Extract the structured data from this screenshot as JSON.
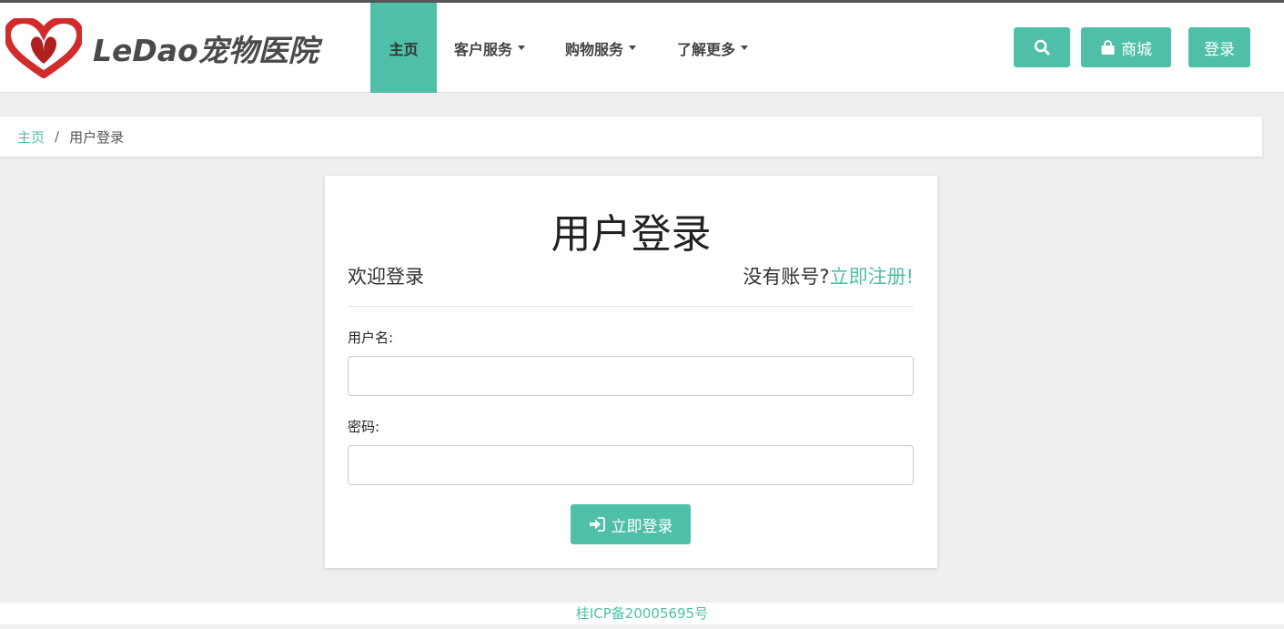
{
  "brand": {
    "text": "LeDao宠物医院",
    "accent_color": "#4fbfa8",
    "logo_icon": "heart-ribbon-logo"
  },
  "nav": {
    "items": [
      {
        "label": "主页",
        "active": true
      },
      {
        "label": "客户服务",
        "dropdown": true
      },
      {
        "label": "购物服务",
        "dropdown": true
      },
      {
        "label": "了解更多",
        "dropdown": true
      }
    ],
    "search_icon": "search-icon",
    "shop_label": "商城",
    "shop_icon": "shopping-bag-icon",
    "login_label": "登录"
  },
  "breadcrumb": {
    "home": "主页",
    "separator": "/",
    "current": "用户登录"
  },
  "login": {
    "title": "用户登录",
    "welcome": "欢迎登录",
    "no_account": "没有账号?",
    "register_link": "立即注册!",
    "username_label": "用户名:",
    "username_value": "",
    "password_label": "密码:",
    "password_value": "",
    "submit_label": "立即登录",
    "submit_icon": "sign-in-icon"
  },
  "footer": {
    "icp": "桂ICP备20005695号"
  }
}
